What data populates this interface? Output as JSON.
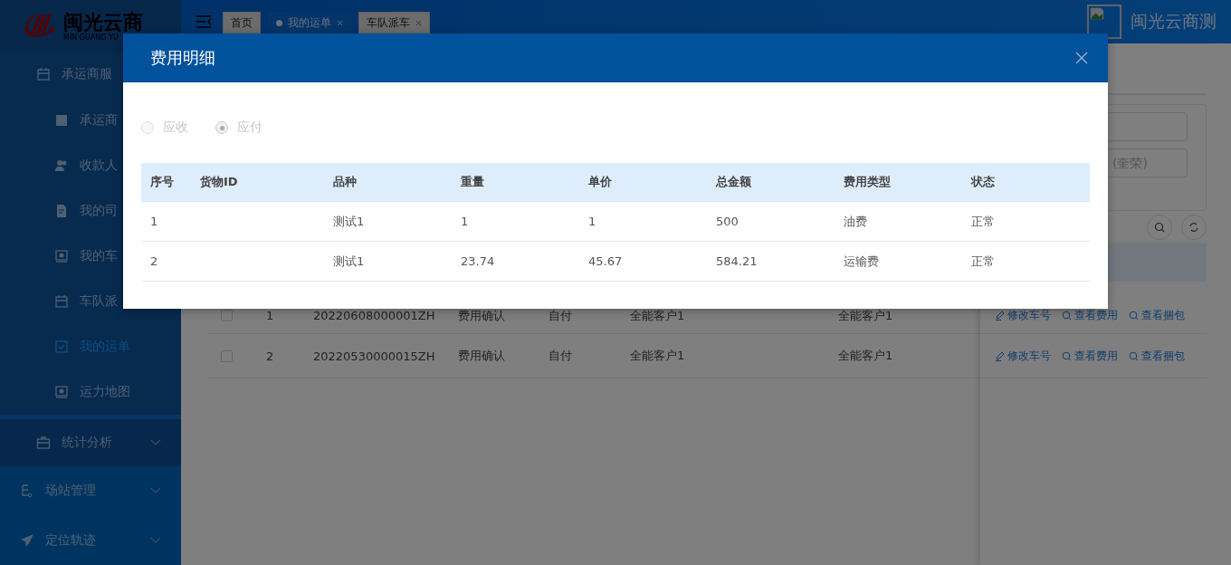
{
  "logo": {
    "name": "闽光云商",
    "subtitle": "MIN GUANG YU"
  },
  "sidebar": {
    "items": [
      {
        "label": "承运商服",
        "kind": "subgroup",
        "expanded": true,
        "children": [
          {
            "label": "承运商",
            "selected": false
          },
          {
            "label": "收款人",
            "selected": false
          },
          {
            "label": "我的司",
            "selected": false
          },
          {
            "label": "我的车",
            "selected": false
          },
          {
            "label": "车队派",
            "selected": false
          },
          {
            "label": "我的运单",
            "selected": true
          },
          {
            "label": "运力地图",
            "selected": false
          }
        ]
      },
      {
        "label": "统计分析",
        "kind": "subgroup",
        "expanded": false
      },
      {
        "label": "场站管理",
        "kind": "group",
        "expanded": false
      },
      {
        "label": "定位轨迹",
        "kind": "group",
        "expanded": false
      }
    ]
  },
  "header": {
    "tabs": [
      {
        "label": "首页",
        "selected": false,
        "closable": false
      },
      {
        "label": "我的运单",
        "selected": true,
        "closable": true
      },
      {
        "label": "车队派车",
        "selected": false,
        "closable": true
      }
    ],
    "user": "闽光云商测"
  },
  "filter": {
    "placeholder": "(奎荣)"
  },
  "table": {
    "rows": [
      {
        "checked": false,
        "cells": [
          "1",
          "20220608000001ZH",
          "费用确认",
          "自付",
          "全能客户1",
          "全能客户1"
        ],
        "actions": [
          "修改车号",
          "查看费用",
          "查看捆包"
        ]
      },
      {
        "checked": false,
        "cells": [
          "2",
          "20220530000015ZH",
          "费用确认",
          "自付",
          "全能客户1",
          "全能客户1"
        ],
        "actions": [
          "修改车号",
          "查看费用",
          "查看捆包"
        ]
      }
    ]
  },
  "modal": {
    "title": "费用明细",
    "radios": [
      {
        "label": "应收",
        "selected": false,
        "disabled": true
      },
      {
        "label": "应付",
        "selected": true,
        "disabled": true
      }
    ],
    "columns": [
      "序号",
      "货物ID",
      "品种",
      "重量",
      "单价",
      "总金额",
      "费用类型",
      "状态"
    ],
    "rows": [
      {
        "no": "1",
        "variety": "测试1",
        "weight": "1",
        "price": "1",
        "total": "500",
        "fee_type": "油费",
        "status": "正常"
      },
      {
        "no": "2",
        "variety": "测试1",
        "weight": "23.74",
        "price": "45.67",
        "total": "584.21",
        "fee_type": "运输费",
        "status": "正常"
      }
    ]
  }
}
